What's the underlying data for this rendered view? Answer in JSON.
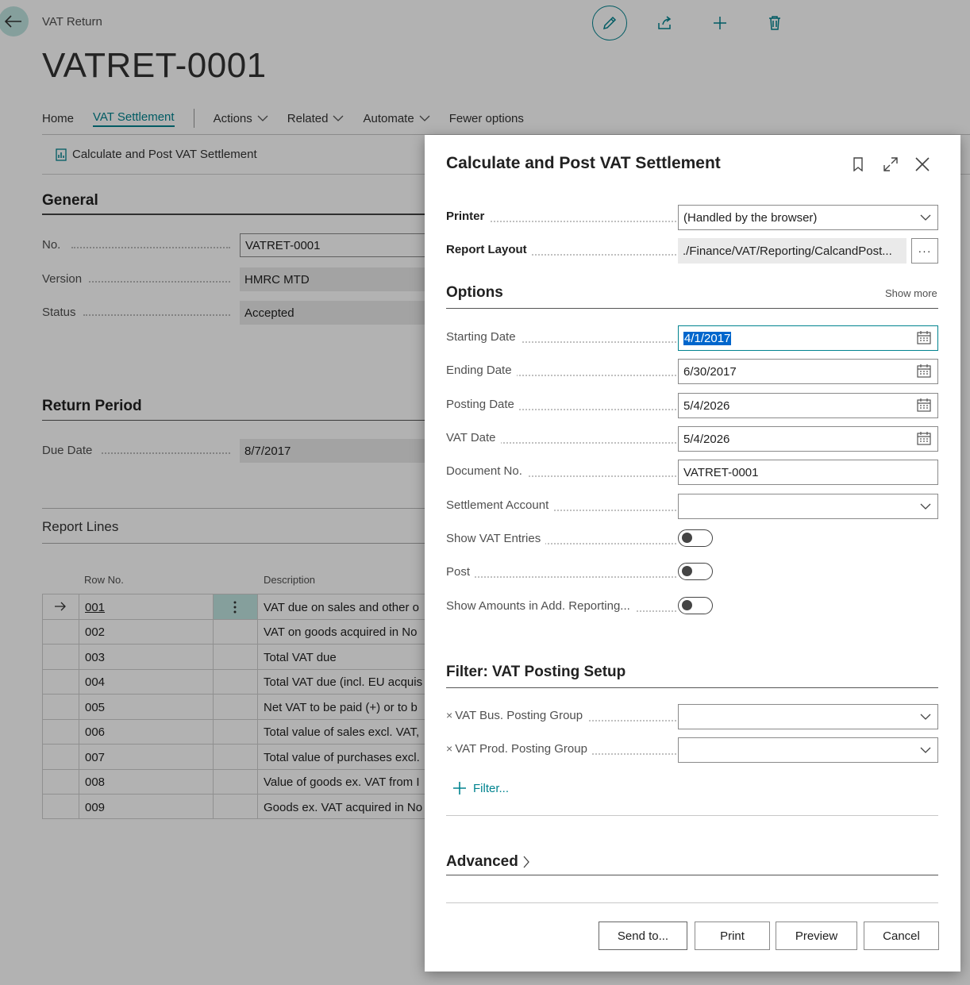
{
  "page": {
    "breadcrumb": "VAT Return",
    "title": "VATRET-0001",
    "toolbar_icons": [
      "edit-icon",
      "share-icon",
      "add-icon",
      "delete-icon"
    ],
    "menu": {
      "home": "Home",
      "vat_settlement": "VAT Settlement",
      "actions": "Actions",
      "related": "Related",
      "automate": "Automate",
      "fewer": "Fewer options"
    },
    "action_button": "Calculate and Post VAT Settlement",
    "general": {
      "heading": "General",
      "no_label": "No.",
      "no_value": "VATRET-0001",
      "version_label": "Version",
      "version_value": "HMRC MTD",
      "status_label": "Status",
      "status_value": "Accepted"
    },
    "return_period": {
      "heading": "Return Period",
      "due_label": "Due Date",
      "due_value": "8/7/2017"
    },
    "report_lines": {
      "heading": "Report Lines",
      "col_row": "Row No.",
      "col_desc": "Description",
      "rows": [
        {
          "no": "001",
          "desc": "VAT due on sales and other o"
        },
        {
          "no": "002",
          "desc": "VAT on goods acquired in No"
        },
        {
          "no": "003",
          "desc": "Total VAT due"
        },
        {
          "no": "004",
          "desc": "Total VAT due (incl. EU acquis"
        },
        {
          "no": "005",
          "desc": "Net VAT to be paid (+) or to b"
        },
        {
          "no": "006",
          "desc": "Total value of sales excl. VAT,"
        },
        {
          "no": "007",
          "desc": "Total value of purchases excl."
        },
        {
          "no": "008",
          "desc": "Value of goods ex. VAT from I"
        },
        {
          "no": "009",
          "desc": "Goods ex. VAT acquired in No"
        }
      ]
    }
  },
  "dialog": {
    "title": "Calculate and Post VAT Settlement",
    "printer_label": "Printer",
    "printer_value": "(Handled by the browser)",
    "layout_label": "Report Layout",
    "layout_value": "./Finance/VAT/Reporting/CalcandPost...",
    "layout_more": "···",
    "options_heading": "Options",
    "show_more": "Show more",
    "starting_label": "Starting Date",
    "starting_value": "4/1/2017",
    "ending_label": "Ending Date",
    "ending_value": "6/30/2017",
    "posting_label": "Posting Date",
    "posting_value": "5/4/2026",
    "vatdate_label": "VAT Date",
    "vatdate_value": "5/4/2026",
    "docno_label": "Document No.",
    "docno_value": "VATRET-0001",
    "settle_label": "Settlement Account",
    "settle_value": "",
    "showvat_label": "Show VAT Entries",
    "showvat_on": false,
    "post_label": "Post",
    "post_on": false,
    "showamt_label": "Show Amounts in Add. Reporting...",
    "showamt_on": false,
    "filter_heading": "Filter: VAT Posting Setup",
    "bus_label": "VAT Bus. Posting Group",
    "bus_value": "",
    "prod_label": "VAT Prod. Posting Group",
    "prod_value": "",
    "remove_mark": "×",
    "add_filter": "Filter...",
    "advanced": "Advanced",
    "buttons": {
      "send": "Send to...",
      "print": "Print",
      "preview": "Preview",
      "cancel": "Cancel"
    }
  },
  "colors": {
    "accent": "#00838f",
    "selection": "#0066cc",
    "overlay": "rgba(0,0,0,0.30)"
  }
}
